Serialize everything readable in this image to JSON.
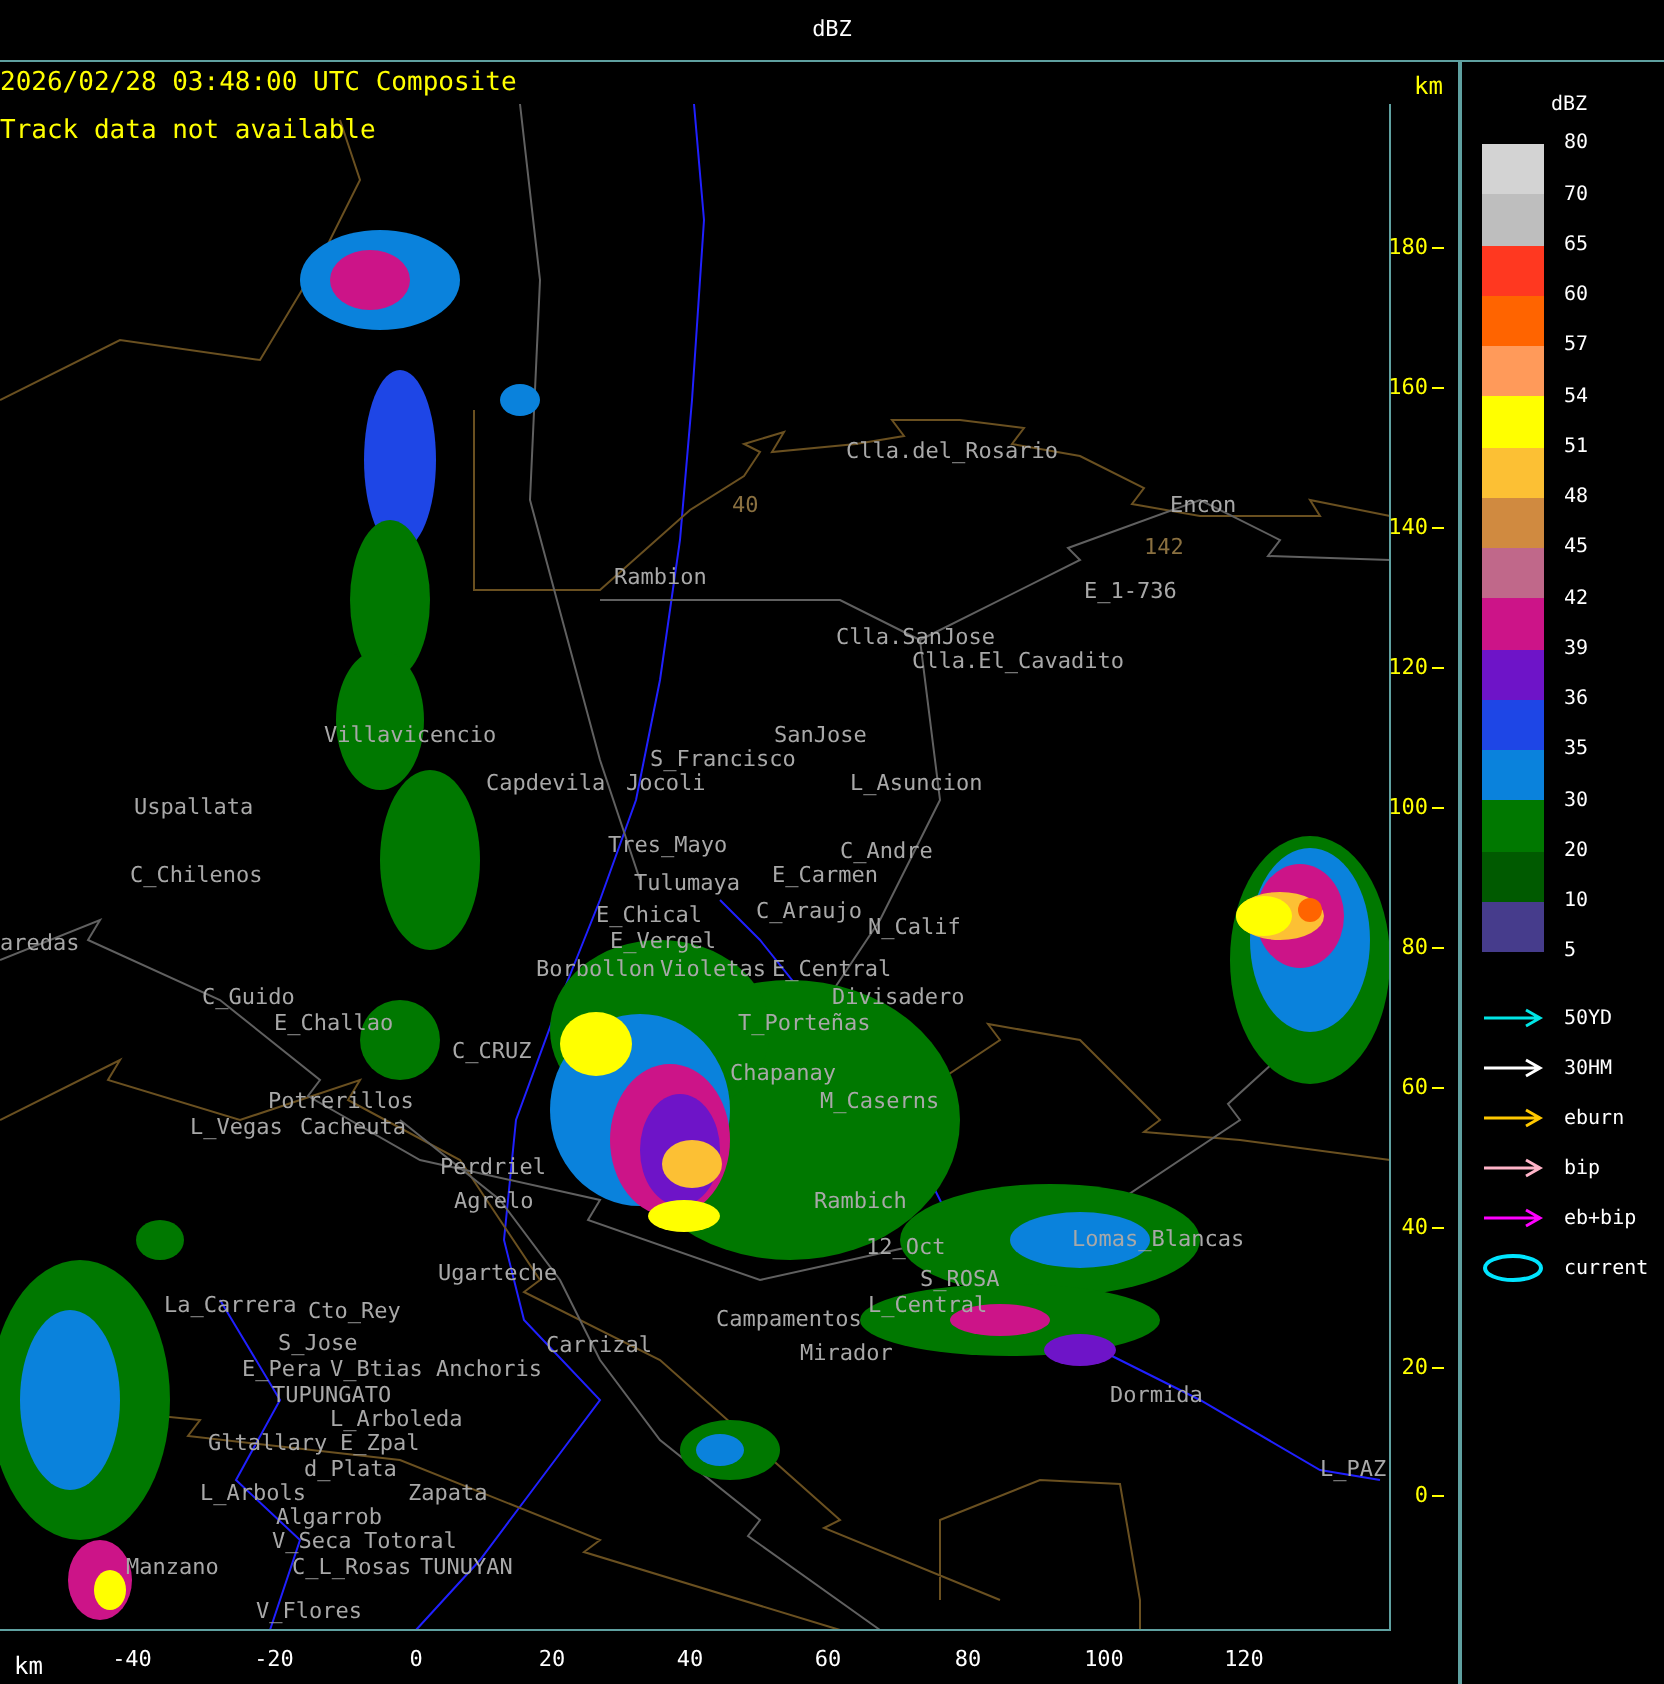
{
  "window": {
    "title": "dBZ"
  },
  "map": {
    "timestamp": "2026/02/28 03:48:00 UTC Composite",
    "status": "Track data not available",
    "km_top": "km",
    "km_bottom": "km",
    "labels": [
      "Clla.del_Rosario",
      "Encon",
      "Rambion",
      "E_1-736",
      "Clla.SanJose",
      "Clla.El_Cavadito",
      "Villavicencio",
      "SanJose",
      "S_Francisco",
      "Capdevila",
      "Jocoli",
      "L_Asuncion",
      "Uspallata",
      "Tres_Mayo",
      "C_Andre",
      "C_Chilenos",
      "Tulumaya",
      "E_Carmen",
      "E_Chical",
      "C_Araujo",
      "N_Calif",
      "aredas",
      "E_Vergel",
      "Borbollon",
      "Violetas",
      "E_Central",
      "C_Guido",
      "Divisadero",
      "E_Challao",
      "T_Porteñas",
      "C_CRUZ",
      "Chapanay",
      "Potrerillos",
      "M_Caserns",
      "L_Vegas",
      "Cacheuta",
      "Perdriel",
      "Agrelo",
      "Rambich",
      "12_Oct",
      "Lomas_Blancas",
      "Ugarteche",
      "S_ROSA",
      "La_Carrera",
      "Cto_Rey",
      "Campamentos",
      "L_Central",
      "S_Jose",
      "Carrizal",
      "Mirador",
      "E_Pera",
      "V_Btias",
      "Anchoris",
      "TUPUNGATO",
      "Dormida",
      "L_Arboleda",
      "Gltallary",
      "E_Zpal",
      "d_Plata",
      "L_PAZ",
      "L_Arbols",
      "Zapata",
      "Algarrob",
      "V_Seca",
      "Totoral",
      "Manzano",
      "C_L_Rosas",
      "TUNUYAN",
      "V_Flores"
    ],
    "route_numbers": [
      "40",
      "142"
    ],
    "y_ticks": [
      "180",
      "160",
      "140",
      "120",
      "100",
      "80",
      "60",
      "40",
      "20",
      "0"
    ],
    "x_ticks": [
      "-40",
      "-20",
      "0",
      "20",
      "40",
      "60",
      "80",
      "100",
      "120"
    ]
  },
  "legend": {
    "title": "dBZ",
    "labels": [
      "80",
      "70",
      "65",
      "60",
      "57",
      "54",
      "51",
      "48",
      "45",
      "42",
      "39",
      "36",
      "35",
      "30",
      "20",
      "10",
      "5"
    ],
    "bins": [
      {
        "color": "#d3d3d3"
      },
      {
        "color": "#bebebe"
      },
      {
        "color": "#ff3820"
      },
      {
        "color": "#ff6400"
      },
      {
        "color": "#ff9a5a"
      },
      {
        "color": "#ffff00"
      },
      {
        "color": "#fcc034"
      },
      {
        "color": "#d08a40"
      },
      {
        "color": "#c0688a"
      },
      {
        "color": "#cc1488"
      },
      {
        "color": "#6e14c8"
      },
      {
        "color": "#1e46e6"
      },
      {
        "color": "#0a82dc"
      },
      {
        "color": "#007800"
      },
      {
        "color": "#005a00"
      },
      {
        "color": "#463c8c"
      }
    ],
    "tracks": [
      {
        "label": "50YD",
        "color": "#00e5e5",
        "kind": "arrow"
      },
      {
        "label": "30HM",
        "color": "#ffffff",
        "kind": "arrow"
      },
      {
        "label": "eburn",
        "color": "#ffc800",
        "kind": "arrow"
      },
      {
        "label": "bip",
        "color": "#ffb4c8",
        "kind": "arrow"
      },
      {
        "label": "eb+bip",
        "color": "#ff00ff",
        "kind": "arrow"
      },
      {
        "label": "current",
        "color": "#00e5ff",
        "kind": "ellipse"
      }
    ]
  }
}
